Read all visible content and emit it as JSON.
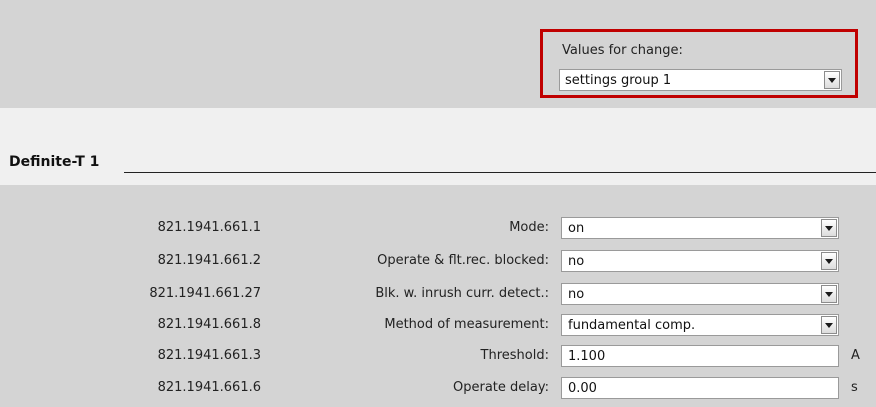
{
  "values_for_change": {
    "label": "Values for change:",
    "selected": "settings group 1"
  },
  "section": {
    "title": "Definite-T 1"
  },
  "parameters": [
    {
      "id": "821.1941.661.1",
      "label": "Mode:",
      "value": "on",
      "kind": "dropdown",
      "unit": ""
    },
    {
      "id": "821.1941.661.2",
      "label": "Operate & flt.rec. blocked:",
      "value": "no",
      "kind": "dropdown",
      "unit": ""
    },
    {
      "id": "821.1941.661.27",
      "label": "Blk. w. inrush curr. detect.:",
      "value": "no",
      "kind": "dropdown",
      "unit": ""
    },
    {
      "id": "821.1941.661.8",
      "label": "Method of measurement:",
      "value": "fundamental comp.",
      "kind": "dropdown",
      "unit": ""
    },
    {
      "id": "821.1941.661.3",
      "label": "Threshold:",
      "value": "1.100",
      "kind": "text",
      "unit": "A"
    },
    {
      "id": "821.1941.661.6",
      "label": "Operate delay:",
      "value": "0.00",
      "kind": "text",
      "unit": "s"
    }
  ],
  "colors": {
    "highlight_border": "#c00000",
    "panel_background": "#d4d4d4"
  }
}
